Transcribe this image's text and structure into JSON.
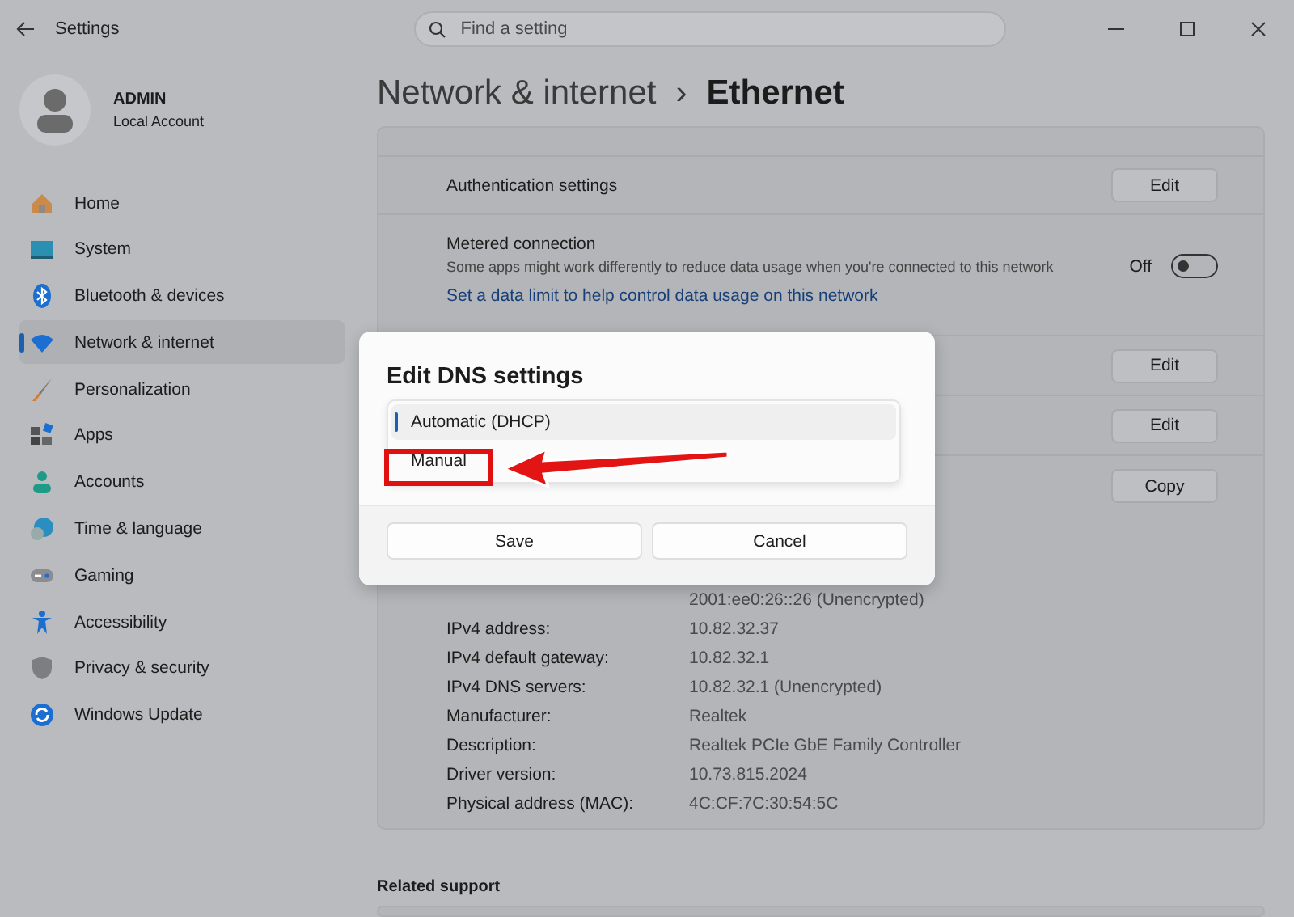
{
  "window": {
    "title": "Settings",
    "search": {
      "placeholder": "Find a setting"
    }
  },
  "profile": {
    "name": "ADMIN",
    "account": "Local Account"
  },
  "sidebar": {
    "items": [
      {
        "label": "Home",
        "selected": false
      },
      {
        "label": "System",
        "selected": false
      },
      {
        "label": "Bluetooth & devices",
        "selected": false
      },
      {
        "label": "Network & internet",
        "selected": true
      },
      {
        "label": "Personalization",
        "selected": false
      },
      {
        "label": "Apps",
        "selected": false
      },
      {
        "label": "Accounts",
        "selected": false
      },
      {
        "label": "Time & language",
        "selected": false
      },
      {
        "label": "Gaming",
        "selected": false
      },
      {
        "label": "Accessibility",
        "selected": false
      },
      {
        "label": "Privacy & security",
        "selected": false
      },
      {
        "label": "Windows Update",
        "selected": false
      }
    ]
  },
  "breadcrumb": {
    "parent": "Network & internet",
    "separator": "›",
    "current": "Ethernet"
  },
  "settings": [
    {
      "kind": "button",
      "label": "Authentication settings",
      "button": "Edit"
    },
    {
      "kind": "toggle",
      "label": "Metered connection",
      "description": "Some apps might work differently to reduce data usage when you're connected to this network",
      "state": "Off",
      "on": false,
      "link": "Set a data limit to help control data usage on this network"
    },
    {
      "kind": "button",
      "button": "Edit"
    },
    {
      "kind": "button",
      "button": "Edit"
    },
    {
      "kind": "button",
      "button": "Copy"
    }
  ],
  "properties": [
    {
      "value": "2001:ee0:26::26 (Unencrypted)"
    },
    {
      "label": "IPv4 address:",
      "value": "10.82.32.37"
    },
    {
      "label": "IPv4 default gateway:",
      "value": "10.82.32.1"
    },
    {
      "label": "IPv4 DNS servers:",
      "value": "10.82.32.1 (Unencrypted)"
    },
    {
      "label": "Manufacturer:",
      "value": "Realtek"
    },
    {
      "label": "Description:",
      "value": "Realtek PCIe GbE Family Controller"
    },
    {
      "label": "Driver version:",
      "value": "10.73.815.2024"
    },
    {
      "label": "Physical address (MAC):",
      "value": "4C:CF:7C:30:54:5C"
    }
  ],
  "related": {
    "title": "Related support"
  },
  "dialog": {
    "title": "Edit DNS settings",
    "options": [
      {
        "label": "Automatic (DHCP)",
        "selected": true
      },
      {
        "label": "Manual",
        "selected": false
      }
    ],
    "buttons": [
      "Save",
      "Cancel"
    ]
  }
}
